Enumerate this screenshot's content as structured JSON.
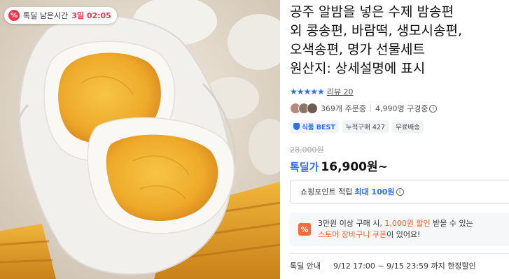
{
  "badge": {
    "icon": "%",
    "label": "톡딜 남은시간",
    "time": "3일 02:05"
  },
  "title_lines": [
    "공주 알밤을 넣은 수제 밤송편",
    "외 콩송편, 바람떡, 생모시송편,",
    "오색송편, 명가 선물세트",
    "원산지: 상세설명에 표시"
  ],
  "rating": {
    "stars": "★★★★★",
    "review": "리뷰 20"
  },
  "stats": {
    "ordering": "369개 주문중",
    "buying": "4,990명 구경중",
    "info_icon": "i"
  },
  "tags": {
    "best": "식품 BEST",
    "cumulative": "누적구매 427",
    "shipping": "무료배송"
  },
  "price": {
    "original": "28,000원",
    "label": "톡딜가",
    "value": "16,900원~"
  },
  "points": {
    "text": "쇼핑포인트 적립",
    "highlight": "최대 100원",
    "info_icon": "i"
  },
  "coupon": {
    "icon": "%",
    "line1_a": "3만원 이상 구매 시, ",
    "line1_b": "1,000원 할인",
    "line1_c": " 받을 수 있는",
    "line2_a": "스토어 장바구니 쿠폰",
    "line2_b": "이 있어요!"
  },
  "deal": {
    "label": "톡딜 안내",
    "period": "9/12 17:00 ~ 9/15 23:59 까지 한정할인"
  },
  "colors": {
    "accent_blue": "#2f6bff",
    "deal_red": "#f0344b",
    "coupon_orange": "#ff5a1f",
    "yolk": "#f2b733",
    "tray": "#e8a21c"
  }
}
